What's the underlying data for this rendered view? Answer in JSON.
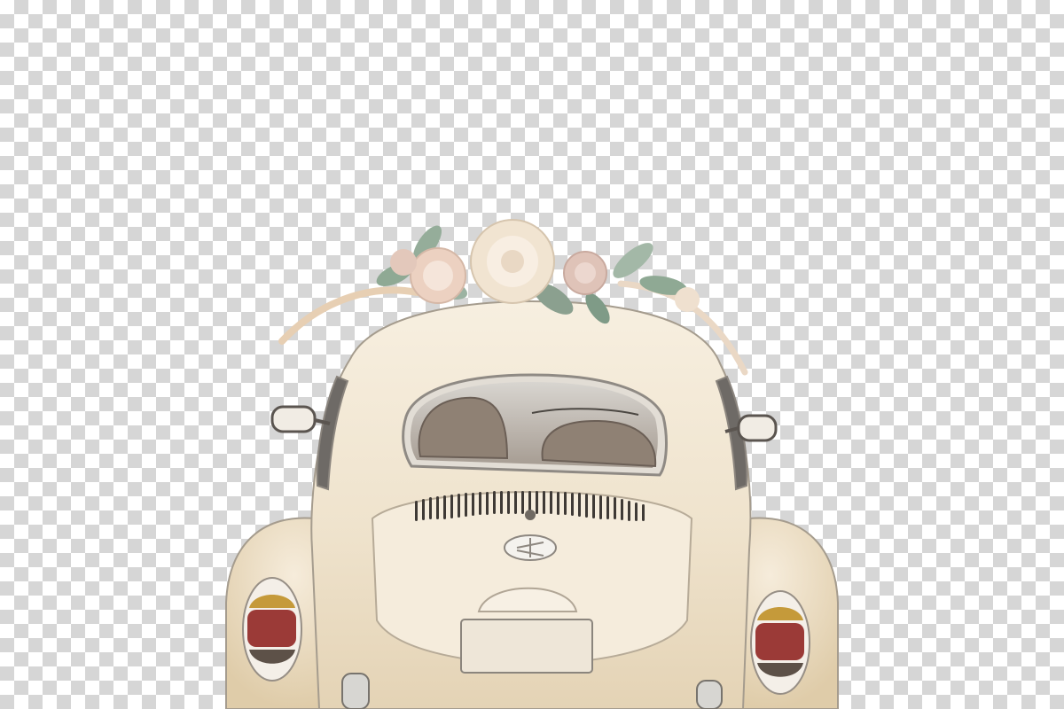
{
  "scene": {
    "subject": "vintage-beetle-car-rear",
    "background": "transparency-checkerboard",
    "decoration": "floral-garland-on-roof"
  },
  "colors": {
    "checker_light": "#ffffff",
    "checker_dark": "#d6d6d6",
    "car_body": "#f1e6d1",
    "car_shadow": "#d9c6a4",
    "outline": "#9b9488",
    "window_frame": "#d7d3cc",
    "seat": "#8b7d70",
    "grille": "#3f3a36",
    "taillight_amber": "#c59a3a",
    "taillight_red": "#9b3a37",
    "taillight_dark": "#5d5148",
    "flower_peach": "#eedcc6",
    "leaf_green": "#8fa994"
  },
  "icons": {
    "emblem": "car-emblem-icon",
    "mirror_left": "side-mirror-icon",
    "mirror_right": "side-mirror-icon"
  }
}
